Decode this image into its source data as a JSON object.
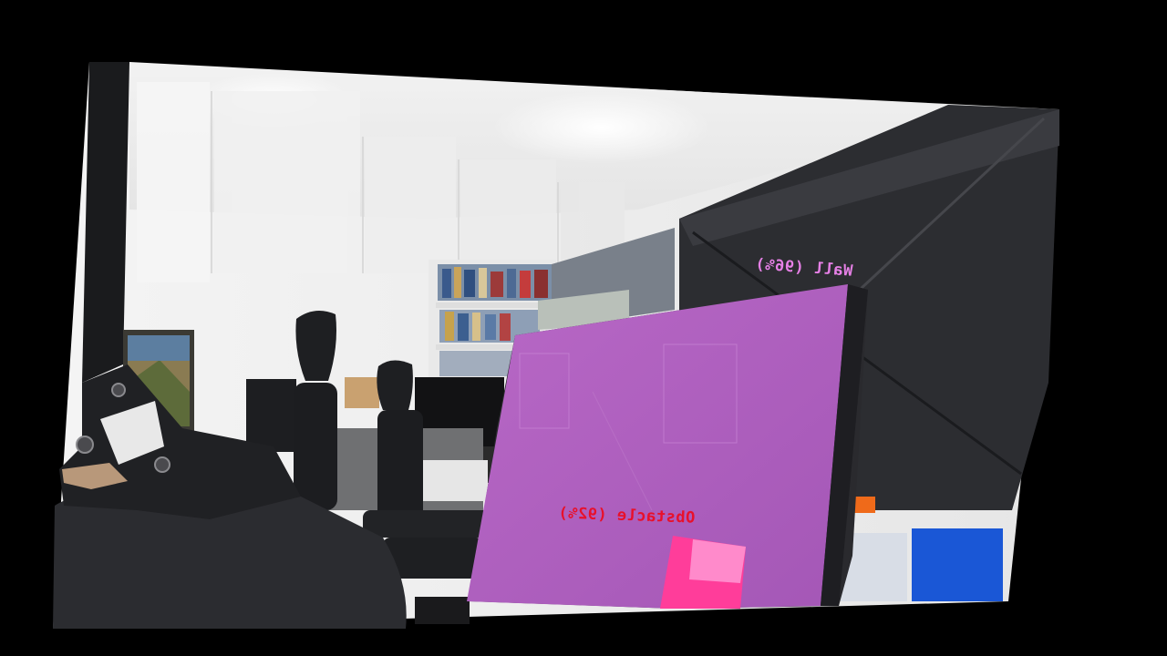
{
  "overlays": {
    "wall": {
      "label": "Wall (96%)",
      "color": "#e680e6"
    },
    "obstacle": {
      "label": "Obstacle (92%)",
      "color": "#e8102a"
    }
  },
  "colors": {
    "background": "#000000",
    "mesh_wall": "#b060c0",
    "mesh_obstacle_highlight": "#ff4aa8"
  }
}
